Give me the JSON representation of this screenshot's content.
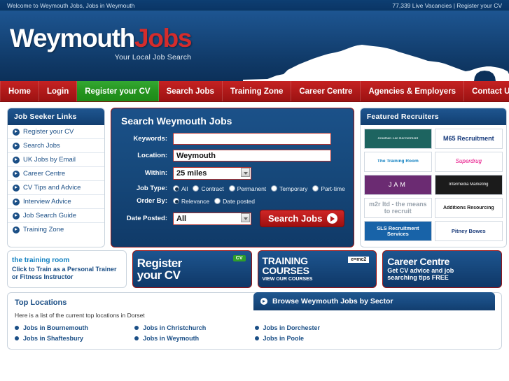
{
  "topbar": {
    "welcome": "Welcome to Weymouth Jobs, Jobs in Weymouth",
    "vacancies": "77,339 Live Vacancies",
    "separator": "|",
    "register_link": "Register your CV"
  },
  "logo": {
    "name_part1": "Weymouth",
    "name_part2": "Jobs",
    "tagline": "Your Local Job Search"
  },
  "nav": {
    "items": [
      {
        "label": "Home",
        "active": false
      },
      {
        "label": "Login",
        "active": false
      },
      {
        "label": "Register your CV",
        "active": true
      },
      {
        "label": "Search Jobs",
        "active": false
      },
      {
        "label": "Training Zone",
        "active": false
      },
      {
        "label": "Career Centre",
        "active": false
      },
      {
        "label": "Agencies & Employers",
        "active": false
      },
      {
        "label": "Contact Us",
        "active": false
      }
    ]
  },
  "sidebar": {
    "title": "Job Seeker Links",
    "items": [
      {
        "label": "Register your CV"
      },
      {
        "label": "Search Jobs"
      },
      {
        "label": "UK Jobs by Email"
      },
      {
        "label": "Career Centre"
      },
      {
        "label": "CV Tips and Advice"
      },
      {
        "label": "Interview Advice"
      },
      {
        "label": "Job Search Guide"
      },
      {
        "label": "Training Zone"
      }
    ]
  },
  "search": {
    "title": "Search Weymouth Jobs",
    "keywords_label": "Keywords:",
    "keywords_value": "",
    "keywords_placeholder": "",
    "location_label": "Location:",
    "location_value": "Weymouth",
    "within_label": "Within:",
    "within_value": "25 miles",
    "within_options": [
      "25 miles"
    ],
    "jobtype_label": "Job Type:",
    "jobtype_options": [
      {
        "label": "All",
        "selected": true
      },
      {
        "label": "Contract",
        "selected": false
      },
      {
        "label": "Permanent",
        "selected": false
      },
      {
        "label": "Temporary",
        "selected": false
      },
      {
        "label": "Part-time",
        "selected": false
      }
    ],
    "orderby_label": "Order By:",
    "orderby_options": [
      {
        "label": "Relevance",
        "selected": true
      },
      {
        "label": "Date posted",
        "selected": false
      }
    ],
    "dateposted_label": "Date Posted:",
    "dateposted_value": "All",
    "dateposted_options": [
      "All"
    ],
    "submit_label": "Search Jobs"
  },
  "recruiters": {
    "title": "Featured Recruiters",
    "items": [
      {
        "name": "Jonathan Lee Recruitment"
      },
      {
        "name": "M65 Recruitment"
      },
      {
        "name": "The Training Room"
      },
      {
        "name": "Superdrug"
      },
      {
        "name": "JAM"
      },
      {
        "name": "Intermedia Marketing"
      },
      {
        "name": "m2r ltd - the means to recruit"
      },
      {
        "name": "Additions Resourcing"
      },
      {
        "name": "SLS Recruitment Services"
      },
      {
        "name": "Pitney Bowes"
      }
    ]
  },
  "promos": [
    {
      "brand": "the training room",
      "line1": "Click to Train as a Personal Trainer",
      "line2": "or Fitness Instructor"
    },
    {
      "line1": "Register",
      "line2": "your CV",
      "badge": "CV"
    },
    {
      "line1": "TRAINING",
      "line2": "COURSES",
      "line3": "VIEW OUR  COURSES",
      "badge": "e=mc2"
    },
    {
      "line1": "Career Centre",
      "line2": "Get CV advice and job",
      "line3": "searching tips FREE"
    }
  ],
  "top_locations": {
    "title": "Top Locations",
    "description": "Here is a list of the current top locations in Dorset",
    "links": [
      "Jobs in Bournemouth",
      "Jobs in Shaftesbury",
      "Jobs in Christchurch",
      "Jobs in Weymouth",
      "Jobs in Dorchester",
      "Jobs in Poole"
    ]
  },
  "sector": {
    "title": "Browse Weymouth Jobs by Sector"
  },
  "colors": {
    "brand_blue": "#17487d",
    "brand_red": "#b51a1a",
    "active_green": "#25951f",
    "link_blue": "#1b4f86"
  }
}
